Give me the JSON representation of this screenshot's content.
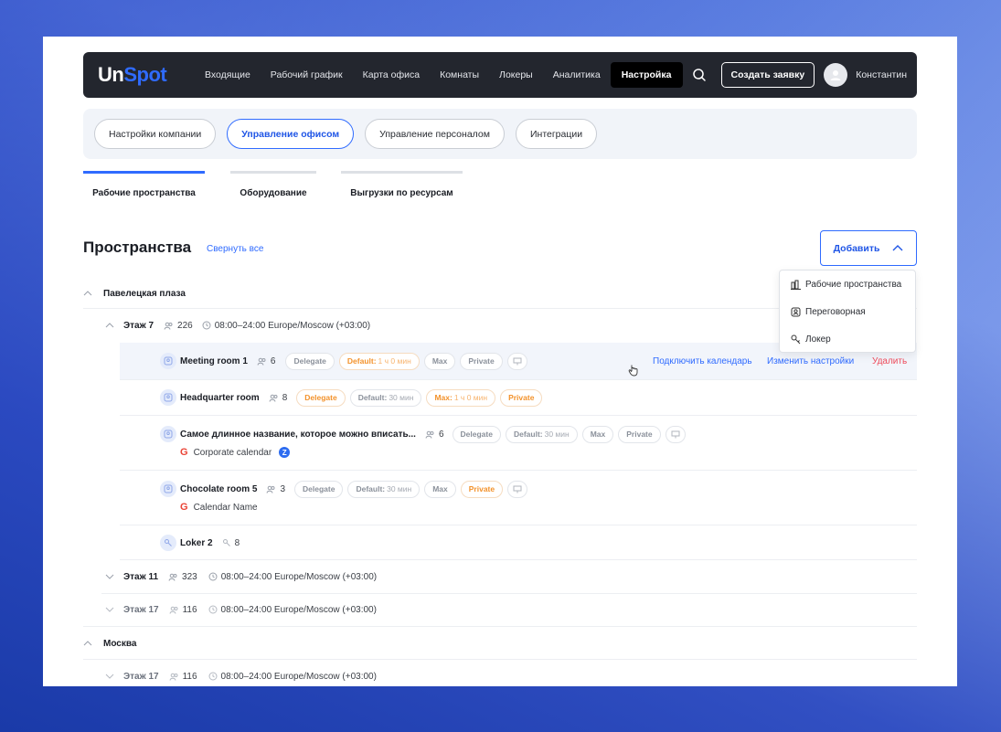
{
  "logo": {
    "un": "Un",
    "spot": "Spot"
  },
  "nav": {
    "items": [
      "Входящие",
      "Рабочий график",
      "Карта офиса",
      "Комнаты",
      "Локеры",
      "Аналитика"
    ],
    "active": "Настройка",
    "create_label": "Создать заявку",
    "user_name": "Константин"
  },
  "pills": [
    "Настройки компании",
    "Управление офисом",
    "Управление персоналом",
    "Интеграции"
  ],
  "utabs": [
    "Рабочие пространства",
    "Оборудование",
    "Выгрузки по ресурсам"
  ],
  "page": {
    "title": "Пространства",
    "collapse_all": "Свернуть все",
    "add_label": "Добавить"
  },
  "dropdown": [
    "Рабочие пространства",
    "Переговорная",
    "Локер"
  ],
  "tree": {
    "site1": "Павелецкая плаза",
    "floor7": {
      "name": "Этаж 7",
      "count": "226",
      "hours": "08:00–24:00 Europe/Moscow (+03:00)"
    },
    "rooms": [
      {
        "name": "Meeting room 1",
        "cap": "6",
        "delegate": "Delegate",
        "def": "Default:",
        "def_val": "1 ч 0 мин",
        "max": "Max",
        "max_val": "",
        "private": "Private"
      },
      {
        "name": "Headquarter room",
        "cap": "8",
        "delegate": "Delegate",
        "def": "Default:",
        "def_val": "30 мин",
        "max": "Max:",
        "max_val": "1 ч 0 мин",
        "private": "Private"
      },
      {
        "name": "Самое длинное название, которое можно вписать...",
        "cap": "6",
        "delegate": "Delegate",
        "def": "Default:",
        "def_val": "30 мин",
        "max": "Max",
        "max_val": "",
        "private": "Private",
        "calendar": "Corporate calendar"
      },
      {
        "name": "Chocolate room 5",
        "cap": "3",
        "delegate": "Delegate",
        "def": "Default:",
        "def_val": "30 мин",
        "max": "Max",
        "max_val": "",
        "private": "Private",
        "calendar": "Calendar Name"
      }
    ],
    "locker": {
      "name": "Loker 2",
      "count": "8"
    },
    "floor11": {
      "name": "Этаж 11",
      "count": "323",
      "hours": "08:00–24:00 Europe/Moscow (+03:00)"
    },
    "floor17": {
      "name": "Этаж 17",
      "count": "116",
      "hours": "08:00–24:00 Europe/Moscow (+03:00)"
    },
    "site2": "Москва",
    "floor17b": {
      "name": "Этаж 17",
      "count": "116",
      "hours": "08:00–24:00 Europe/Moscow (+03:00)"
    }
  },
  "row_actions": {
    "connect": "Подключить календарь",
    "edit": "Изменить настройки",
    "delete": "Удалить"
  },
  "colors": {
    "accent": "#2f6bff",
    "nav_bg": "#23262e",
    "orange": "#f3922b",
    "danger": "#ef4b5b"
  }
}
